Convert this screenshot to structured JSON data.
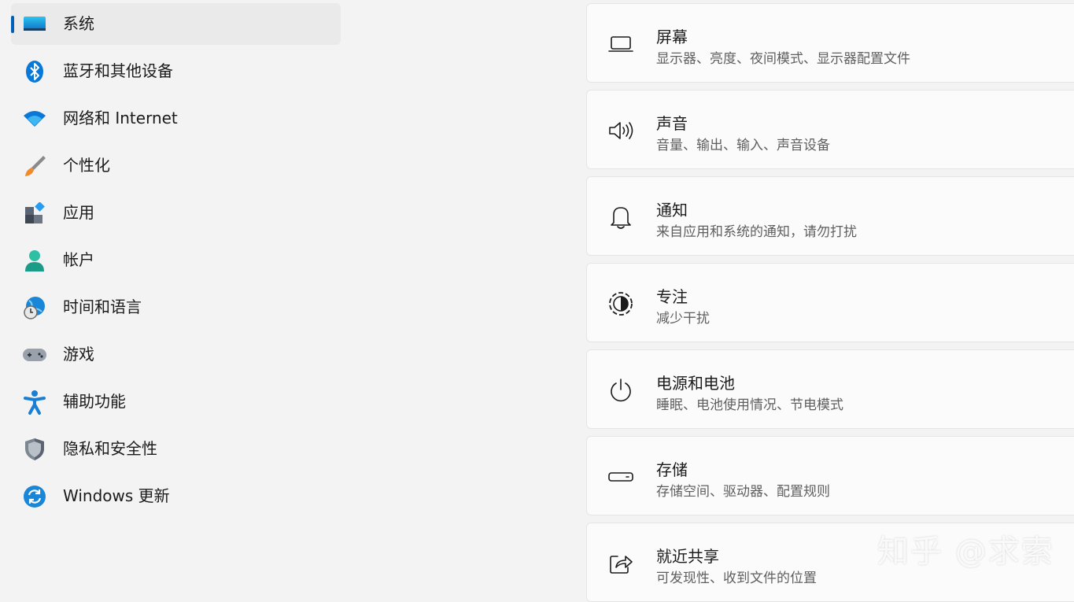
{
  "sidebar": {
    "items": [
      {
        "label": "系统",
        "icon": "system-display-icon",
        "selected": true
      },
      {
        "label": "蓝牙和其他设备",
        "icon": "bluetooth-icon"
      },
      {
        "label": "网络和 Internet",
        "icon": "wifi-icon"
      },
      {
        "label": "个性化",
        "icon": "paintbrush-icon"
      },
      {
        "label": "应用",
        "icon": "apps-icon"
      },
      {
        "label": "帐户",
        "icon": "account-icon"
      },
      {
        "label": "时间和语言",
        "icon": "globe-clock-icon"
      },
      {
        "label": "游戏",
        "icon": "gamepad-icon"
      },
      {
        "label": "辅助功能",
        "icon": "accessibility-icon"
      },
      {
        "label": "隐私和安全性",
        "icon": "shield-icon"
      },
      {
        "label": "Windows 更新",
        "icon": "windows-update-icon"
      }
    ]
  },
  "main": {
    "cards": [
      {
        "title": "屏幕",
        "desc": "显示器、亮度、夜间模式、显示器配置文件",
        "icon": "laptop-icon"
      },
      {
        "title": "声音",
        "desc": "音量、输出、输入、声音设备",
        "icon": "speaker-icon"
      },
      {
        "title": "通知",
        "desc": "来自应用和系统的通知，请勿打扰",
        "icon": "bell-icon"
      },
      {
        "title": "专注",
        "desc": "减少干扰",
        "icon": "focus-icon"
      },
      {
        "title": "电源和电池",
        "desc": "睡眠、电池使用情况、节电模式",
        "icon": "power-icon"
      },
      {
        "title": "存储",
        "desc": "存储空间、驱动器、配置规则",
        "icon": "storage-drive-icon"
      },
      {
        "title": "就近共享",
        "desc": "可发现性、收到文件的位置",
        "icon": "share-icon"
      }
    ]
  },
  "watermark": "知乎 @求索",
  "colors": {
    "accent": "#005fb8",
    "background": "#f3f3f3",
    "card": "#fbfbfb",
    "selected": "#eaeaea"
  }
}
